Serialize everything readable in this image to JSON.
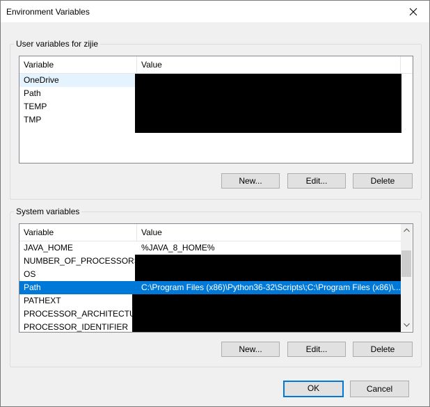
{
  "window": {
    "title": "Environment Variables"
  },
  "user_vars": {
    "legend": "User variables for zijie",
    "col_variable": "Variable",
    "col_value": "Value",
    "rows": [
      {
        "name": "OneDrive",
        "value": ""
      },
      {
        "name": "Path",
        "value": ""
      },
      {
        "name": "TEMP",
        "value": ""
      },
      {
        "name": "TMP",
        "value": ""
      }
    ],
    "buttons": {
      "new": "New...",
      "edit": "Edit...",
      "delete": "Delete"
    }
  },
  "system_vars": {
    "legend": "System variables",
    "col_variable": "Variable",
    "col_value": "Value",
    "rows": [
      {
        "name": "JAVA_HOME",
        "value": "%JAVA_8_HOME%"
      },
      {
        "name": "NUMBER_OF_PROCESSORS",
        "value": ""
      },
      {
        "name": "OS",
        "value": ""
      },
      {
        "name": "Path",
        "value": "C:\\Program Files (x86)\\Python36-32\\Scripts\\;C:\\Program Files (x86)\\..."
      },
      {
        "name": "PATHEXT",
        "value": ""
      },
      {
        "name": "PROCESSOR_ARCHITECTURE",
        "value": ""
      },
      {
        "name": "PROCESSOR_IDENTIFIER",
        "value": ""
      }
    ],
    "buttons": {
      "new": "New...",
      "edit": "Edit...",
      "delete": "Delete"
    }
  },
  "footer": {
    "ok": "OK",
    "cancel": "Cancel"
  },
  "colors": {
    "selection": "#0078d7",
    "default_border": "#0078d7",
    "redaction": "#000000"
  }
}
